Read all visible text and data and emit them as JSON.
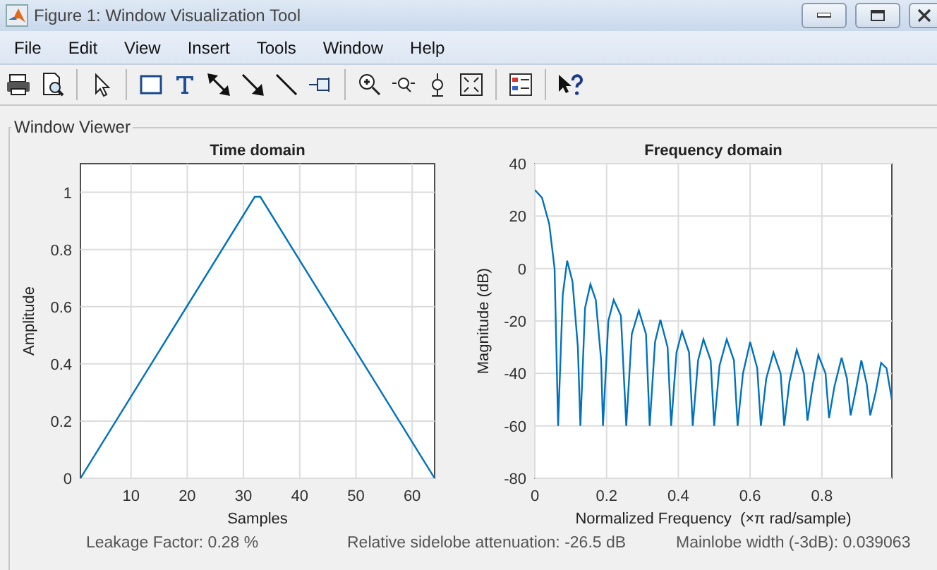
{
  "window": {
    "title": "Figure 1: Window Visualization Tool"
  },
  "menu": [
    "File",
    "Edit",
    "View",
    "Insert",
    "Tools",
    "Window",
    "Help"
  ],
  "panel": {
    "title": "Window Viewer"
  },
  "time_chart": {
    "chart_data": {
      "type": "line",
      "title": "Time domain",
      "xlabel": "Samples",
      "ylabel": "Amplitude",
      "x": [
        1,
        32,
        33,
        64
      ],
      "series": [
        {
          "color": "#0072bd",
          "values": [
            0,
            0.984,
            0.984,
            0
          ]
        }
      ],
      "xlim": [
        1,
        64
      ],
      "ylim": [
        0,
        1.1
      ],
      "xticks": [
        10,
        20,
        30,
        40,
        50,
        60
      ],
      "yticks": [
        0,
        0.2,
        0.4,
        0.6,
        0.8,
        1
      ],
      "grid": true
    }
  },
  "frequency_chart": {
    "chart_data": {
      "type": "line",
      "title": "Frequency domain",
      "xlabel": "Normalized Frequency  (×π rad/sample)",
      "ylabel": "Magnitude (dB)",
      "x": [
        0,
        0.02,
        0.04,
        0.055,
        0.065,
        0.078,
        0.09,
        0.105,
        0.12,
        0.127,
        0.14,
        0.155,
        0.17,
        0.185,
        0.19,
        0.205,
        0.22,
        0.24,
        0.255,
        0.27,
        0.29,
        0.31,
        0.32,
        0.335,
        0.35,
        0.37,
        0.38,
        0.395,
        0.41,
        0.43,
        0.44,
        0.455,
        0.47,
        0.49,
        0.5,
        0.515,
        0.535,
        0.555,
        0.565,
        0.58,
        0.6,
        0.62,
        0.63,
        0.645,
        0.665,
        0.685,
        0.695,
        0.71,
        0.73,
        0.75,
        0.76,
        0.775,
        0.79,
        0.81,
        0.82,
        0.835,
        0.855,
        0.87,
        0.88,
        0.895,
        0.91,
        0.925,
        0.935,
        0.95,
        0.965,
        0.98,
        0.995
      ],
      "series": [
        {
          "color": "#0072bd",
          "values": [
            30,
            27,
            17,
            0,
            -60,
            -10,
            3,
            -5,
            -30,
            -60,
            -15,
            -6,
            -12,
            -35,
            -60,
            -20,
            -12,
            -18,
            -60,
            -25,
            -16,
            -25,
            -60,
            -28,
            -19.5,
            -30,
            -60,
            -32,
            -24,
            -32,
            -60,
            -35,
            -27,
            -35,
            -60,
            -37,
            -27,
            -35,
            -60,
            -40,
            -28,
            -38,
            -60,
            -42,
            -32,
            -40,
            -60,
            -43,
            -31,
            -40,
            -58,
            -44,
            -33,
            -40,
            -57,
            -45,
            -34,
            -42,
            -56,
            -46,
            -35,
            -44,
            -56,
            -47,
            -36,
            -38,
            -50
          ]
        }
      ],
      "xlim": [
        0,
        0.995
      ],
      "ylim": [
        -80,
        40
      ],
      "xticks": [
        0,
        0.2,
        0.4,
        0.6,
        0.8
      ],
      "yticks": [
        -80,
        -60,
        -40,
        -20,
        0,
        20,
        40
      ],
      "grid": true
    }
  },
  "status": [
    "Leakage Factor: 0.28 %",
    "Relative sidelobe attenuation: -26.5 dB",
    "Mainlobe width (-3dB): 0.039063"
  ]
}
